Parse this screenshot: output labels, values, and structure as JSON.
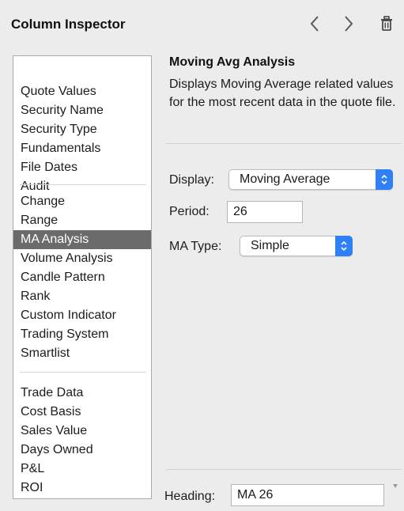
{
  "header": {
    "title": "Column Inspector",
    "back_icon": "chevron-left-icon",
    "forward_icon": "chevron-right-icon",
    "delete_icon": "trash-icon"
  },
  "categories": {
    "groups": [
      [
        "Quote Values",
        "Security Name",
        "Security Type",
        "Fundamentals",
        "File Dates",
        "Audit"
      ],
      [
        "Change",
        "Range",
        "MA Analysis",
        "Volume Analysis",
        "Candle Pattern",
        "Rank",
        "Custom Indicator",
        "Trading System",
        "Smartlist"
      ],
      [
        "Trade Data",
        "Cost Basis",
        "Sales Value",
        "Days Owned",
        "P&L",
        "ROI"
      ]
    ],
    "selected": "MA Analysis"
  },
  "detail": {
    "title": "Moving Avg Analysis",
    "description": "Displays Moving Average related values for the most recent data in the quote file.",
    "display_label": "Display:",
    "display_value": "Moving Average",
    "period_label": "Period:",
    "period_value": "26",
    "ma_type_label": "MA Type:",
    "ma_type_value": "Simple",
    "heading_label": "Heading:",
    "heading_value": "MA 26"
  },
  "colors": {
    "accent": "#2f7ff5",
    "selection": "#6b6b6b",
    "background": "#ececec"
  }
}
